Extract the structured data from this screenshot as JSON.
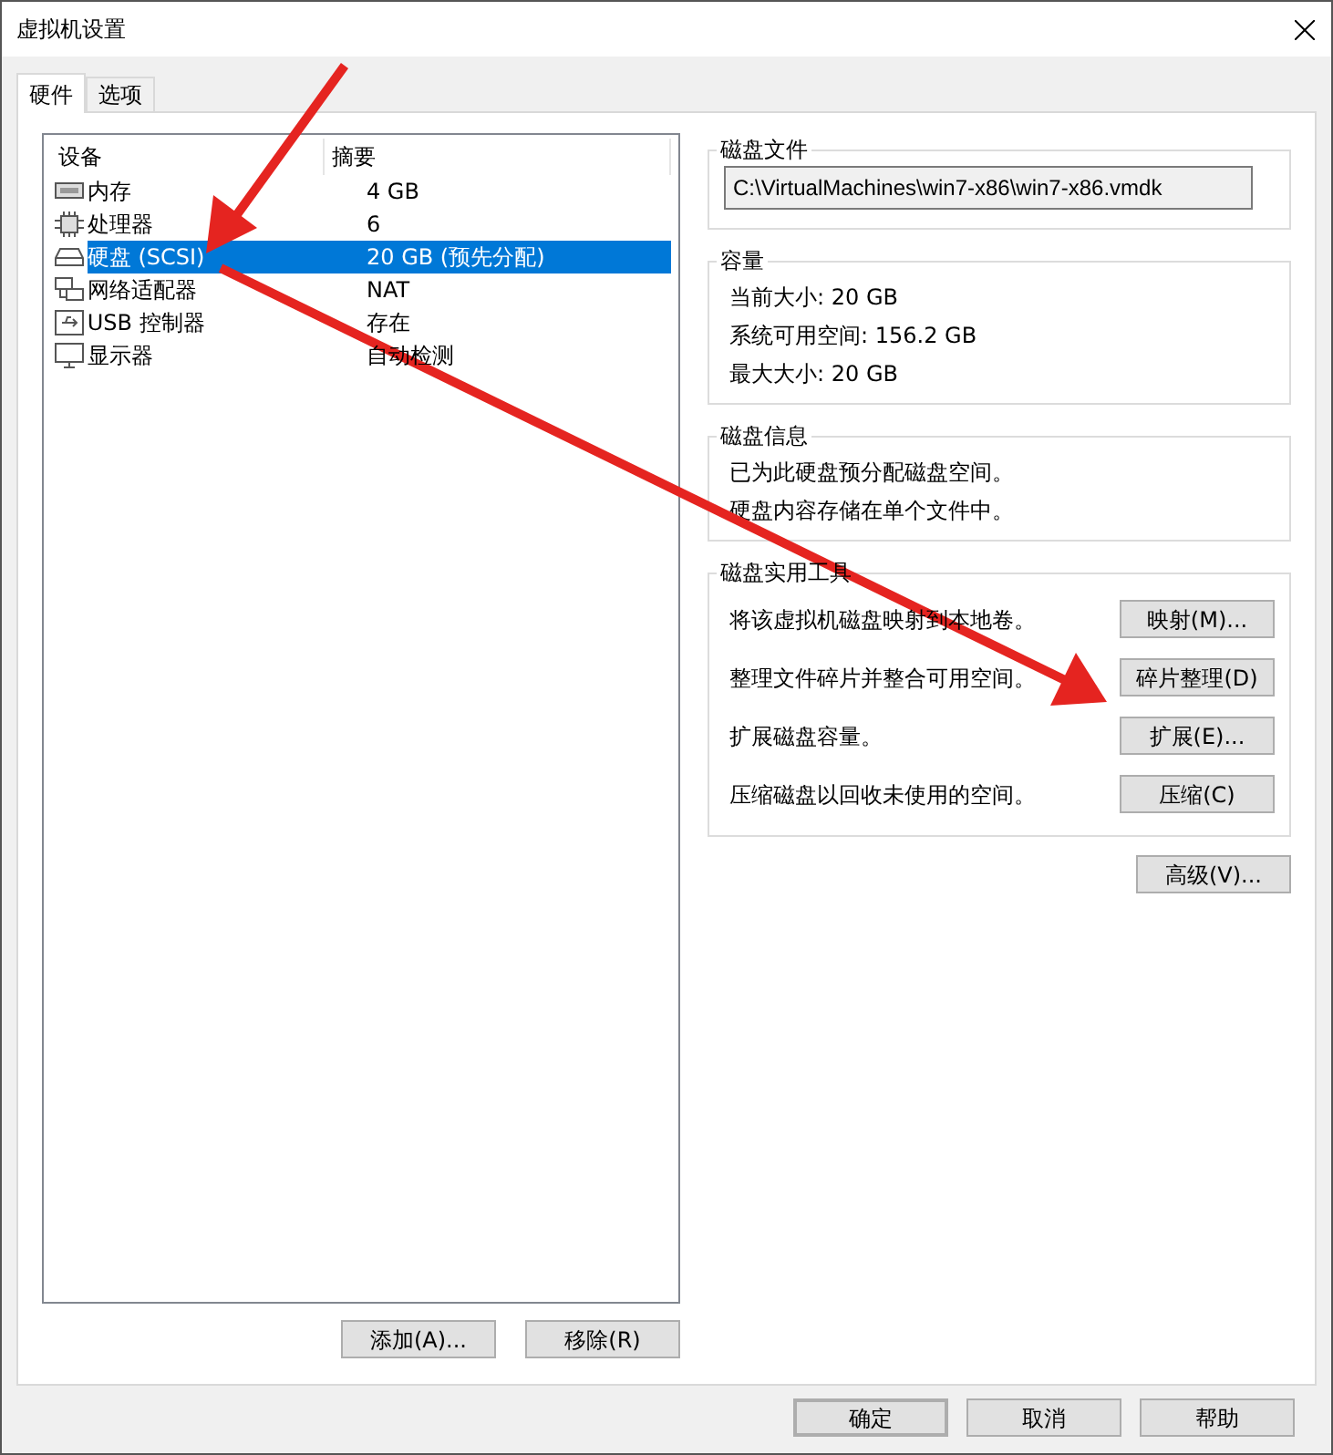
{
  "window": {
    "title": "虚拟机设置"
  },
  "tabs": [
    {
      "label": "硬件",
      "selected": true
    },
    {
      "label": "选项",
      "selected": false
    }
  ],
  "device_table": {
    "columns": [
      "设备",
      "摘要"
    ],
    "rows": [
      {
        "kind": "memory",
        "device": "内存",
        "summary": "4 GB",
        "selected": false
      },
      {
        "kind": "cpu",
        "device": "处理器",
        "summary": "6",
        "selected": false
      },
      {
        "kind": "disk",
        "device": "硬盘 (SCSI)",
        "summary": "20 GB (预先分配)",
        "selected": true
      },
      {
        "kind": "network",
        "device": "网络适配器",
        "summary": "NAT",
        "selected": false
      },
      {
        "kind": "usb",
        "device": "USB 控制器",
        "summary": "存在",
        "selected": false
      },
      {
        "kind": "display",
        "device": "显示器",
        "summary": "自动检测",
        "selected": false
      }
    ]
  },
  "device_buttons": [
    "添加(A)...",
    "移除(R)"
  ],
  "disk_file": {
    "title": "磁盘文件",
    "value": "C:\\VirtualMachines\\win7-x86\\win7-x86.vmdk"
  },
  "capacity": {
    "title": "容量",
    "lines": [
      "当前大小: 20 GB",
      "系统可用空间: 156.2 GB",
      "最大大小: 20 GB"
    ]
  },
  "disk_info": {
    "title": "磁盘信息",
    "lines": [
      "已为此硬盘预分配磁盘空间。",
      "硬盘内容存储在单个文件中。"
    ]
  },
  "disk_utilities": {
    "title": "磁盘实用工具",
    "rows": [
      {
        "text": "将该虚拟机磁盘映射到本地卷。",
        "button": "映射(M)..."
      },
      {
        "text": "整理文件碎片并整合可用空间。",
        "button": "碎片整理(D)"
      },
      {
        "text": "扩展磁盘容量。",
        "button": "扩展(E)..."
      },
      {
        "text": "压缩磁盘以回收未使用的空间。",
        "button": "压缩(C)"
      }
    ]
  },
  "advanced_button": "高级(V)...",
  "dialog_buttons": [
    {
      "label": "确定",
      "default": true
    },
    {
      "label": "取消",
      "default": false
    },
    {
      "label": "帮助",
      "default": false
    }
  ]
}
